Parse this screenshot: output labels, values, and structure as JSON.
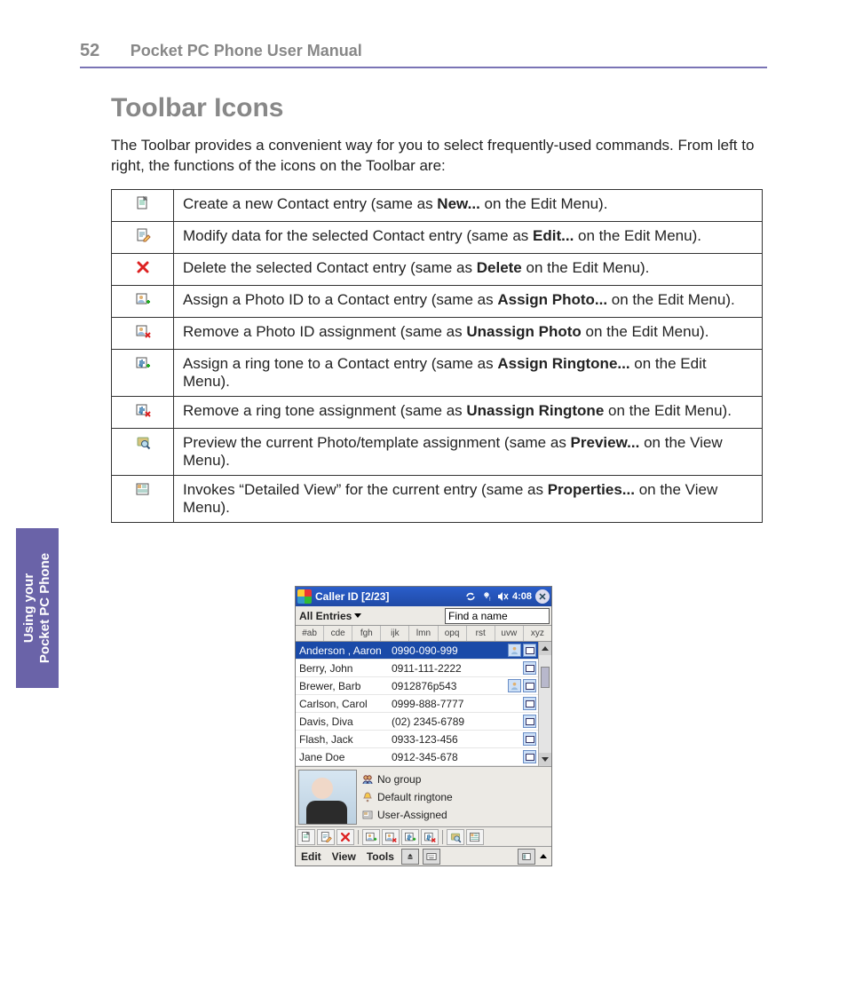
{
  "header": {
    "page_number": "52",
    "manual_title": "Pocket PC Phone User Manual"
  },
  "side_tab": "Using your\nPocket PC Phone",
  "section": {
    "title": "Toolbar Icons",
    "intro": "The Toolbar provides a convenient way for you to select frequently-used commands.  From left to right, the functions of the icons on the Toolbar are:"
  },
  "table": [
    {
      "icon": "new",
      "pre": "Create a new Contact entry (same as ",
      "bold": "New...",
      "post": " on the Edit Menu)."
    },
    {
      "icon": "edit",
      "pre": "Modify data for the selected Contact entry (same as ",
      "bold": "Edit...",
      "post": " on the Edit Menu)."
    },
    {
      "icon": "delete",
      "pre": "Delete the selected Contact entry (same as ",
      "bold": "Delete",
      "post": " on the Edit Menu)."
    },
    {
      "icon": "assign-photo",
      "pre": "Assign a Photo ID to a Contact entry (same as ",
      "bold": "Assign Photo...",
      "post": " on the Edit Menu)."
    },
    {
      "icon": "unassign-photo",
      "pre": "Remove a Photo ID assignment (same as ",
      "bold": "Unassign Photo",
      "post": " on the Edit Menu)."
    },
    {
      "icon": "assign-ring",
      "pre": "Assign a ring tone to a Contact entry (same as ",
      "bold": "Assign Ringtone...",
      "post": " on the Edit Menu)."
    },
    {
      "icon": "unassign-ring",
      "pre": "Remove a ring tone assignment (same as ",
      "bold": "Unassign Ringtone",
      "post": " on the Edit Menu)."
    },
    {
      "icon": "preview",
      "pre": "Preview the current Photo/template assignment (same as ",
      "bold": "Preview...",
      "post": " on the View Menu)."
    },
    {
      "icon": "properties",
      "pre": "Invokes “Detailed View” for the current entry (same as ",
      "bold": "Properties...",
      "post": " on the View Menu)."
    }
  ],
  "device": {
    "title": "Caller ID [2/23]",
    "clock": "4:08",
    "filter_label": "All Entries",
    "search_placeholder": "Find a name",
    "alpha_tabs": [
      "#ab",
      "cde",
      "fgh",
      "ijk",
      "lmn",
      "opq",
      "rst",
      "uvw",
      "xyz"
    ],
    "contacts": [
      {
        "name": "Anderson , Aaron",
        "phone": "0990-090-999",
        "selected": true,
        "badges": [
          "photo",
          "card"
        ]
      },
      {
        "name": "Berry, John",
        "phone": "0911-111-2222",
        "selected": false,
        "badges": [
          "card"
        ]
      },
      {
        "name": "Brewer, Barb",
        "phone": "0912876p543",
        "selected": false,
        "badges": [
          "photo",
          "card"
        ]
      },
      {
        "name": "Carlson, Carol",
        "phone": "0999-888-7777",
        "selected": false,
        "badges": [
          "card"
        ]
      },
      {
        "name": "Davis, Diva",
        "phone": "(02) 2345-6789",
        "selected": false,
        "badges": [
          "card"
        ]
      },
      {
        "name": "Flash, Jack",
        "phone": "0933-123-456",
        "selected": false,
        "badges": [
          "card"
        ]
      },
      {
        "name": "Jane Doe",
        "phone": "0912-345-678",
        "selected": false,
        "badges": [
          "card"
        ]
      }
    ],
    "detail": {
      "group": "No group",
      "ringtone": "Default ringtone",
      "template": "User-Assigned"
    },
    "toolbar": [
      "new",
      "edit",
      "delete",
      "assign-photo",
      "unassign-photo",
      "assign-ring",
      "unassign-ring",
      "preview",
      "properties"
    ],
    "menu": [
      "Edit",
      "View",
      "Tools"
    ]
  }
}
